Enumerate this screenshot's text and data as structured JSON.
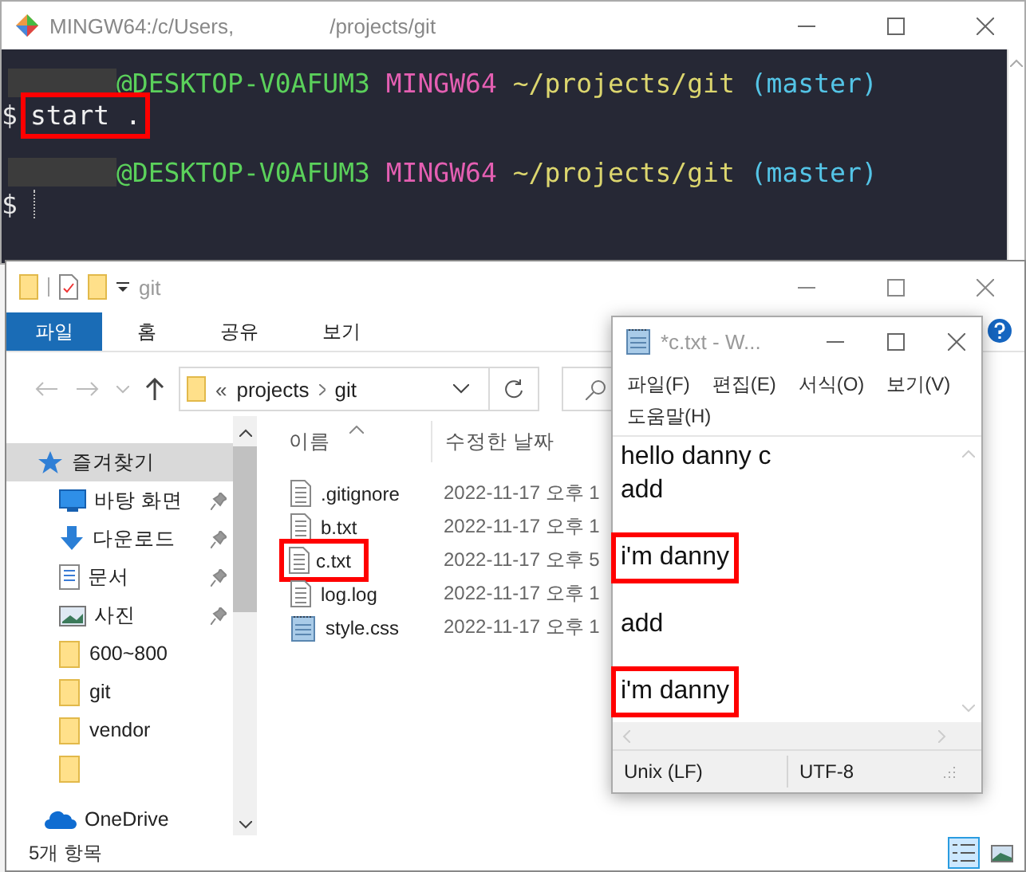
{
  "terminal": {
    "title": [
      "MINGW64:/c/Users,",
      "/projects/git"
    ],
    "lines": [
      {
        "kind": "prompt",
        "host": "@DESKTOP-V0AFUM3",
        "shell": "MINGW64",
        "path": "~/projects/git",
        "branch": "(master)"
      },
      {
        "kind": "command",
        "symbol": "$",
        "text": "start .",
        "highlighted": true
      },
      {
        "kind": "blank"
      },
      {
        "kind": "prompt",
        "host": "@DESKTOP-V0AFUM3",
        "shell": "MINGW64",
        "path": "~/projects/git",
        "branch": "(master)"
      },
      {
        "kind": "cursor",
        "symbol": "$"
      }
    ]
  },
  "explorer": {
    "title": "git",
    "ribbon_tabs": [
      {
        "label": "파일",
        "selected": true
      },
      {
        "label": "홈",
        "selected": false
      },
      {
        "label": "공유",
        "selected": false
      },
      {
        "label": "보기",
        "selected": false
      }
    ],
    "address": {
      "overflow": "«",
      "crumbs": [
        "projects",
        "git"
      ]
    },
    "nav": [
      {
        "label": "즐겨찾기",
        "kind": "star",
        "selected": true,
        "children": [
          {
            "label": "바탕 화면",
            "kind": "desktop",
            "selected": false,
            "pinned": true
          },
          {
            "label": "다운로드",
            "kind": "download",
            "selected": false,
            "pinned": true
          },
          {
            "label": "문서",
            "kind": "document",
            "selected": false,
            "pinned": true
          },
          {
            "label": "사진",
            "kind": "pictures",
            "selected": false,
            "pinned": true
          },
          {
            "label": "600~800",
            "kind": "folder",
            "selected": false,
            "pinned": false
          },
          {
            "label": "git",
            "kind": "folder",
            "selected": false,
            "pinned": false
          },
          {
            "label": "vendor",
            "kind": "folder",
            "selected": false,
            "pinned": false
          },
          {
            "kind": "folder",
            "selected": false,
            "pinned": false
          }
        ]
      },
      {
        "label": "OneDrive",
        "kind": "cloud",
        "selected": false
      }
    ],
    "columns": [
      "이름",
      "수정한 날짜"
    ],
    "files": [
      {
        "name": ".gitignore",
        "kind": "text",
        "modified": "2022-11-17 오후 1",
        "highlighted": false
      },
      {
        "name": "b.txt",
        "kind": "text",
        "modified": "2022-11-17 오후 1",
        "highlighted": false
      },
      {
        "name": "c.txt",
        "kind": "text",
        "modified": "2022-11-17 오후 5",
        "highlighted": true
      },
      {
        "name": "log.log",
        "kind": "text",
        "modified": "2022-11-17 오후 1",
        "highlighted": false
      },
      {
        "name": "style.css",
        "kind": "css",
        "modified": "2022-11-17 오후 1",
        "highlighted": false
      }
    ],
    "status": "5개 항목",
    "views": [
      {
        "kind": "details",
        "selected": true
      },
      {
        "kind": "tiles",
        "selected": false
      }
    ]
  },
  "notepad": {
    "title": "*c.txt - W...",
    "menus": [
      "파일(F)",
      "편집(E)",
      "서식(O)",
      "보기(V)",
      "도움말(H)"
    ],
    "lines": [
      {
        "kind": "text",
        "text": "hello danny c",
        "highlighted": false
      },
      {
        "kind": "text",
        "text": "add",
        "highlighted": false
      },
      {
        "kind": "blank"
      },
      {
        "kind": "text",
        "text": "i'm danny",
        "highlighted": true
      },
      {
        "kind": "blank"
      },
      {
        "kind": "text",
        "text": "add",
        "highlighted": false
      },
      {
        "kind": "blank"
      },
      {
        "kind": "text",
        "text": "i'm danny",
        "highlighted": true
      }
    ],
    "status": [
      "Unix (LF)",
      "UTF-8"
    ]
  }
}
